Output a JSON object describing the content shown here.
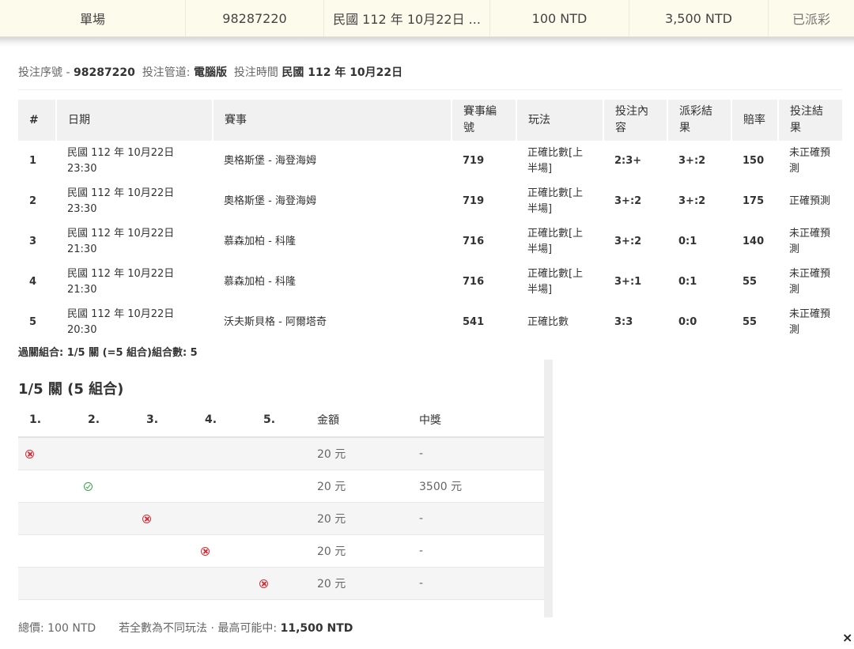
{
  "summary": {
    "type": "單場",
    "bet_id": "98287220",
    "date": "民國 112 年 10月22日 ...",
    "stake": "100 NTD",
    "payout": "3,500 NTD",
    "status": "已派彩"
  },
  "info": {
    "bet_id_label": "投注序號 -",
    "bet_id": "98287220",
    "channel_label": "投注管道:",
    "channel": "電腦版",
    "time_label": "投注時間",
    "time": "民國 112 年 10月22日"
  },
  "table": {
    "headers": [
      "#",
      "日期",
      "賽事",
      "賽事編號",
      "玩法",
      "投注內容",
      "派彩結果",
      "賠率",
      "投注結果"
    ],
    "rows": [
      {
        "no": "1",
        "date": "民國 112 年 10月22日 23:30",
        "match": "奧格斯堡 - 海登海姆",
        "match_no": "719",
        "market": "正確比數[上半場]",
        "pick": "2:3+",
        "result": "3+:2",
        "odds": "150",
        "outcome": "未正確預測"
      },
      {
        "no": "2",
        "date": "民國 112 年 10月22日 23:30",
        "match": "奧格斯堡 - 海登海姆",
        "match_no": "719",
        "market": "正確比數[上半場]",
        "pick": "3+:2",
        "result": "3+:2",
        "odds": "175",
        "outcome": "正確預測"
      },
      {
        "no": "3",
        "date": "民國 112 年 10月22日 21:30",
        "match": "慕森加柏 - 科隆",
        "match_no": "716",
        "market": "正確比數[上半場]",
        "pick": "3+:2",
        "result": "0:1",
        "odds": "140",
        "outcome": "未正確預測"
      },
      {
        "no": "4",
        "date": "民國 112 年 10月22日 21:30",
        "match": "慕森加柏 - 科隆",
        "match_no": "716",
        "market": "正確比數[上半場]",
        "pick": "3+:1",
        "result": "0:1",
        "odds": "55",
        "outcome": "未正確預測"
      },
      {
        "no": "5",
        "date": "民國 112 年 10月22日 20:30",
        "match": "沃夫斯貝格 - 阿爾塔奇",
        "match_no": "541",
        "market": "正確比數",
        "pick": "3:3",
        "result": "0:0",
        "odds": "55",
        "outcome": "未正確預測"
      }
    ]
  },
  "combo": {
    "summary": "過關組合: 1/5 關 (=5 組合)組合數: 5",
    "title": "1/5 關 (5 組合)",
    "headers": [
      "1.",
      "2.",
      "3.",
      "4.",
      "5.",
      "金額",
      "中獎"
    ],
    "rows": [
      {
        "amount": "20 元",
        "prize": "-",
        "icon": "lose-icon"
      },
      {
        "amount": "20 元",
        "prize": "3500 元",
        "icon": "win-icon"
      },
      {
        "amount": "20 元",
        "prize": "-",
        "icon": "lose-icon"
      },
      {
        "amount": "20 元",
        "prize": "-",
        "icon": "lose-icon"
      },
      {
        "amount": "20 元",
        "prize": "-",
        "icon": "lose-icon"
      }
    ]
  },
  "footer": {
    "total_label": "總價:",
    "total": "100 NTD",
    "max_label": "若全數為不同玩法 · 最高可能中:",
    "max": "11,500 NTD"
  },
  "close_label": "×",
  "colors": {
    "topbar_bg": "#fdfbeb",
    "lose": "#d0303a",
    "win": "#3aa050"
  }
}
